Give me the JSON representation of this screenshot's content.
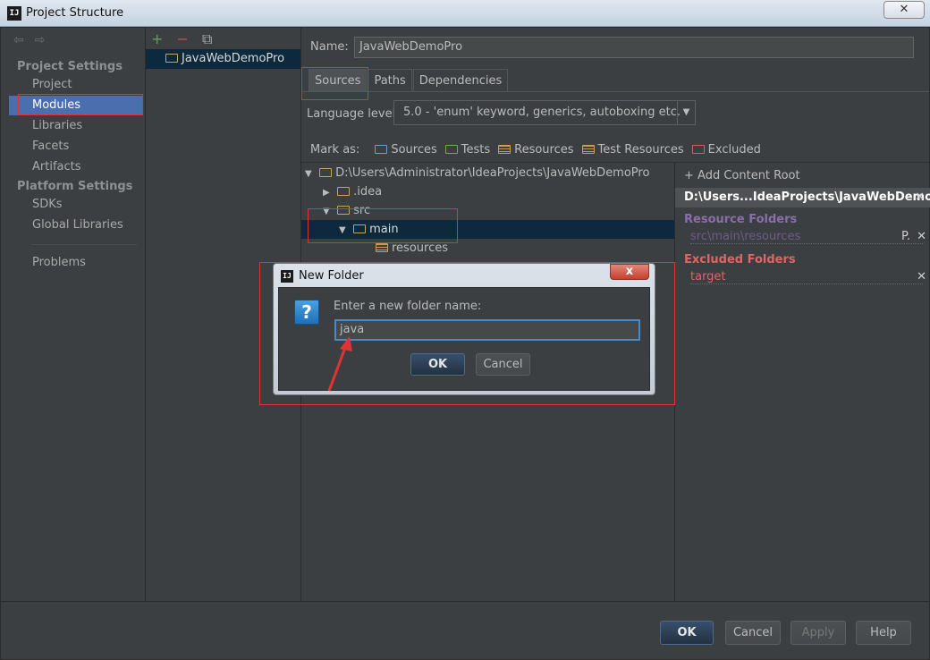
{
  "window": {
    "title": "Project Structure",
    "icon": "intellij-icon",
    "close": "✕"
  },
  "nav": {
    "back_icon": "arrow-left-icon",
    "forward_icon": "arrow-right-icon",
    "project_settings_header": "Project Settings",
    "project_settings": [
      "Project",
      "Modules",
      "Libraries",
      "Facets",
      "Artifacts"
    ],
    "platform_settings_header": "Platform Settings",
    "platform_settings": [
      "SDKs",
      "Global Libraries"
    ],
    "problems": "Problems",
    "selected": "Modules"
  },
  "modules": {
    "add": "+",
    "remove": "−",
    "copy": "⧉",
    "items": [
      "JavaWebDemoPro"
    ]
  },
  "module": {
    "name_label": "Name:",
    "name_value": "JavaWebDemoPro",
    "tabs": [
      "Sources",
      "Paths",
      "Dependencies"
    ],
    "active_tab": "Sources",
    "language_label": "Language level:",
    "language_value": "5.0 - 'enum' keyword, generics, autoboxing etc.",
    "mark_as_label": "Mark as:",
    "mark_as": [
      "Sources",
      "Tests",
      "Resources",
      "Test Resources",
      "Excluded"
    ]
  },
  "tree": {
    "root": "D:\\Users\\Administrator\\IdeaProjects\\JavaWebDemoPro",
    "idea": ".idea",
    "src": "src",
    "main": "main",
    "resources": "resources"
  },
  "content_root": {
    "add_label": "+ Add Content Root",
    "path": "D:\\Users...IdeaProjects\\JavaWebDemoPro",
    "resource_header": "Resource Folders",
    "resource_value": "src\\main\\resources",
    "resource_props": "P.",
    "excluded_header": "Excluded Folders",
    "excluded_value": "target",
    "remove": "✕"
  },
  "dialog": {
    "title": "New Folder",
    "icon": "question-icon",
    "icon_glyph": "?",
    "prompt": "Enter a new folder name:",
    "input_value": "java",
    "ok": "OK",
    "cancel": "Cancel",
    "close": "x"
  },
  "footer": {
    "ok": "OK",
    "cancel": "Cancel",
    "apply": "Apply",
    "help": "Help"
  },
  "colors": {
    "accent": "#4b6eaf",
    "annotation": "#e03434",
    "resource": "#8a6eaa",
    "excluded": "#e06464"
  }
}
